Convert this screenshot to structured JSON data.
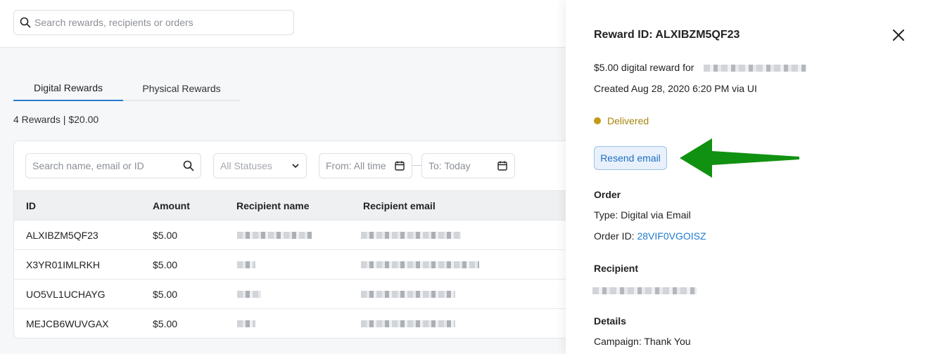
{
  "global_search": {
    "placeholder": "Search rewards, recipients or orders",
    "icon": "search-icon"
  },
  "tabs": [
    {
      "label": "Digital Rewards",
      "active": true
    },
    {
      "label": "Physical Rewards",
      "active": false
    }
  ],
  "summary": "4 Rewards | $20.00",
  "filters": {
    "search_placeholder": "Search name, email or ID",
    "status_label": "All Statuses",
    "from_label": "From: All time",
    "to_label": "To: Today"
  },
  "table": {
    "columns": [
      "ID",
      "Amount",
      "Recipient name",
      "Recipient email"
    ],
    "rows": [
      {
        "id": "ALXIBZM5QF23",
        "amount": "$5.00"
      },
      {
        "id": "X3YR01IMLRKH",
        "amount": "$5.00"
      },
      {
        "id": "UO5VL1UCHAYG",
        "amount": "$5.00"
      },
      {
        "id": "MEJCB6WUVGAX",
        "amount": "$5.00"
      }
    ]
  },
  "drawer": {
    "title": "Reward ID: ALXIBZM5QF23",
    "reward_line": "$5.00 digital reward for",
    "created_line": "Created Aug 28, 2020 6:20 PM via UI",
    "status": "Delivered",
    "status_color": "#c49a16",
    "resend_label": "Resend email",
    "order_heading": "Order",
    "order_type": "Type: Digital via Email",
    "order_id_label": "Order ID:",
    "order_id": "28VIF0VGOISZ",
    "recipient_heading": "Recipient",
    "details_heading": "Details",
    "campaign": "Campaign: Thank You"
  },
  "colors": {
    "accent": "#2a7bd1",
    "arrow": "#119111"
  }
}
